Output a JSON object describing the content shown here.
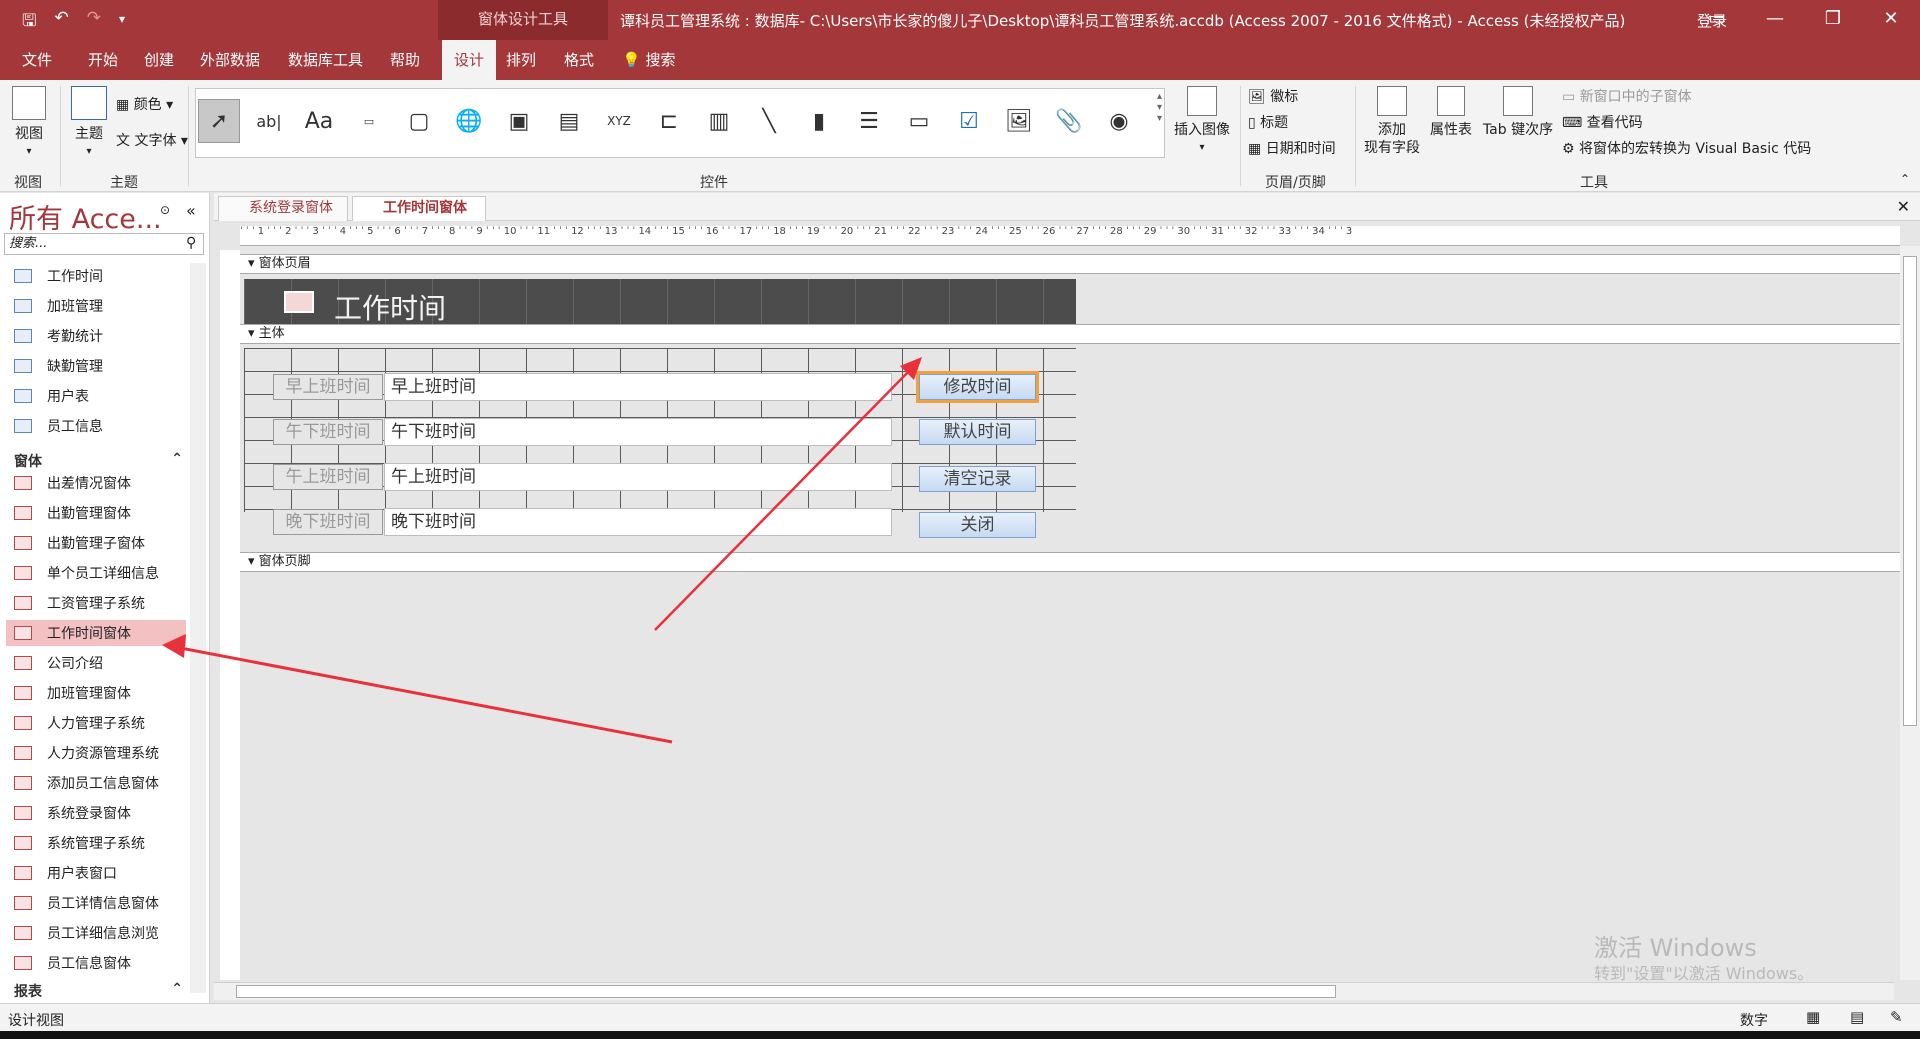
{
  "titlebar": {
    "context_tools": "窗体设计工具",
    "doc_title": "谭科员工管理系统 : 数据库- C:\\Users\\市长家的傻儿子\\Desktop\\谭科员工管理系统.accdb (Access 2007 - 2016 文件格式)  -  Access (未经授权产品)",
    "login": "登录"
  },
  "tabs": [
    "文件",
    "开始",
    "创建",
    "外部数据",
    "数据库工具",
    "帮助",
    "设计",
    "排列",
    "格式"
  ],
  "search": "搜索",
  "ribbon": {
    "view": "视图",
    "theme": "主题",
    "color": "颜色",
    "font": "文字体",
    "controls_group": "控件",
    "insert_image": "插入图像",
    "logo": "徽标",
    "title": "标题",
    "datetime": "日期和时间",
    "hf_group": "页眉/页脚",
    "add_field_1": "添加",
    "add_field_2": "现有字段",
    "prop_sheet": "属性表",
    "tab_order": "Tab 键次序",
    "subform": "新窗口中的子窗体",
    "view_code": "查看代码",
    "convert_macro": "将窗体的宏转换为 Visual Basic 代码",
    "tools_group": "工具",
    "view_group": "视图",
    "theme_group": "主题"
  },
  "nav": {
    "title": "所有 Acce...",
    "search_placeholder": "搜索...",
    "tables": [
      "工作时间",
      "加班管理",
      "考勤统计",
      "缺勤管理",
      "用户表",
      "员工信息"
    ],
    "forms_header": "窗体",
    "forms": [
      "出差情况窗体",
      "出勤管理窗体",
      "出勤管理子窗体",
      "单个员工详细信息",
      "工资管理子系统",
      "工作时间窗体",
      "公司介绍",
      "加班管理窗体",
      "人力管理子系统",
      "人力资源管理系统",
      "添加员工信息窗体",
      "系统登录窗体",
      "系统管理子系统",
      "用户表窗口",
      "员工详情信息窗体",
      "员工详细信息浏览",
      "员工信息窗体"
    ],
    "reports_header": "报表"
  },
  "doc_tabs": [
    "系统登录窗体",
    "工作时间窗体"
  ],
  "designer": {
    "header_section": "窗体页眉",
    "detail_section": "主体",
    "footer_section": "窗体页脚",
    "header_title": "工作时间",
    "labels": [
      "早上班时间",
      "午下班时间",
      "午上班时间",
      "晚下班时间"
    ],
    "textboxes": [
      "早上班时间",
      "午下班时间",
      "午上班时间",
      "晚下班时间"
    ],
    "buttons": [
      "修改时间",
      "默认时间",
      "清空记录",
      "关闭"
    ]
  },
  "status": {
    "left": "设计视图",
    "right": "数字"
  },
  "watermark": {
    "line1": "激活 Windows",
    "line2": "转到\"设置\"以激活 Windows。"
  },
  "colors": {
    "accent": "#a4373a",
    "selection": "#f3c1c1",
    "arrow": "#e8313b"
  }
}
